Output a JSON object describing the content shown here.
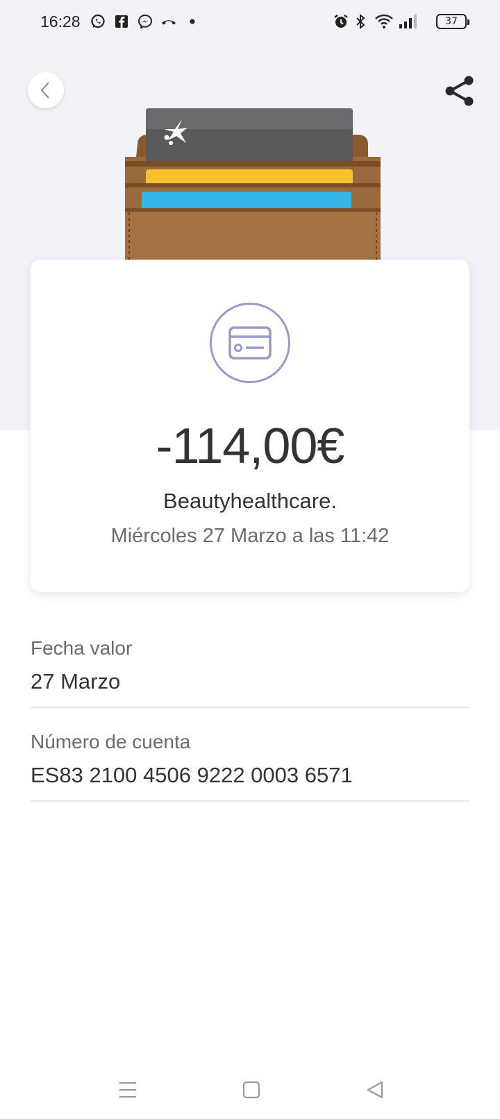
{
  "status_bar": {
    "time": "16:28",
    "battery": "37",
    "icons": [
      "whatsapp-icon",
      "facebook-icon",
      "messenger-icon",
      "missed-call-icon",
      "dot-icon",
      "alarm-icon",
      "bluetooth-icon",
      "wifi-icon",
      "signal-icon",
      "battery-icon"
    ]
  },
  "header": {
    "back_icon": "chevron-left-icon",
    "share_icon": "share-icon"
  },
  "colors": {
    "hero_background": "#f3f2f8",
    "icon_ring": "#9a9ac8",
    "wallet_leather": "#9b6a3c",
    "card_gray": "#5a5a5c",
    "card_yellow": "#f5c12e",
    "card_blue": "#35b6e6"
  },
  "transaction": {
    "amount": "-114,00€",
    "merchant": "Beautyhealthcare.",
    "datetime": "Miércoles 27 Marzo a las 11:42",
    "icon": "credit-card-icon"
  },
  "details": [
    {
      "label": "Fecha valor",
      "value": "27 Marzo"
    },
    {
      "label": "Número de cuenta",
      "value": "ES83 2100 4506 9222 0003 6571"
    }
  ],
  "nav": {
    "icons": [
      "menu-icon",
      "home-icon",
      "back-triangle-icon"
    ]
  }
}
